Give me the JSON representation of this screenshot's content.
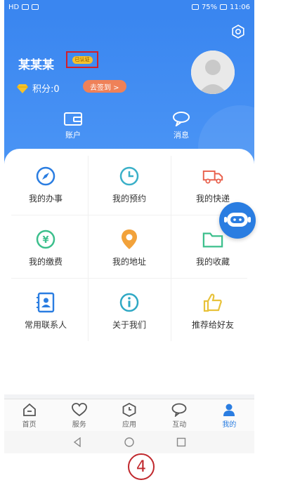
{
  "status_bar": {
    "left": "HD",
    "battery": "75%",
    "time": "11:06"
  },
  "profile": {
    "name": "某某某",
    "tag": "已认证",
    "points_label": "积分:0",
    "sign_in": "去签到 >"
  },
  "quick_actions": [
    {
      "label": "账户",
      "icon": "wallet-icon"
    },
    {
      "label": "消息",
      "icon": "message-icon"
    }
  ],
  "grid": [
    {
      "label": "我的办事",
      "icon": "compass-icon"
    },
    {
      "label": "我的预约",
      "icon": "clock-icon"
    },
    {
      "label": "我的快递",
      "icon": "truck-icon"
    },
    {
      "label": "我的缴费",
      "icon": "yen-icon"
    },
    {
      "label": "我的地址",
      "icon": "location-icon"
    },
    {
      "label": "我的收藏",
      "icon": "folder-icon"
    },
    {
      "label": "常用联系人",
      "icon": "contact-icon"
    },
    {
      "label": "关于我们",
      "icon": "info-icon"
    },
    {
      "label": "推荐给好友",
      "icon": "thumbs-up-icon"
    }
  ],
  "tabs": [
    {
      "label": "首页",
      "icon": "home-icon"
    },
    {
      "label": "服务",
      "icon": "heart-icon"
    },
    {
      "label": "应用",
      "icon": "app-icon"
    },
    {
      "label": "互动",
      "icon": "chat-icon"
    },
    {
      "label": "我的",
      "icon": "person-icon",
      "active": true
    }
  ],
  "step_marker": "4",
  "colors": {
    "primary": "#3a86f0",
    "accent": "#ef8158",
    "tag": "#f6c22c",
    "highlight_box": "#d31f2a"
  }
}
